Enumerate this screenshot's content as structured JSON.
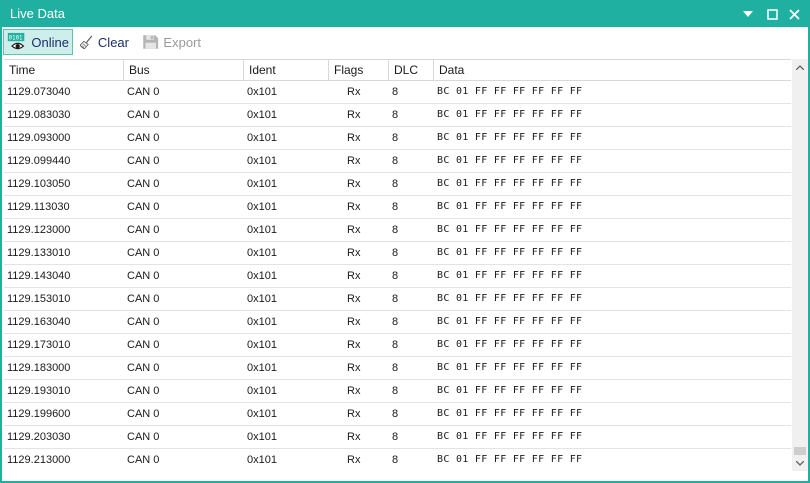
{
  "window": {
    "title": "Live Data"
  },
  "toolbar": {
    "online_label": "Online",
    "online_icon_text": "0101",
    "clear_label": "Clear",
    "export_label": "Export"
  },
  "columns": [
    "Time",
    "Bus",
    "Ident",
    "Flags",
    "DLC",
    "Data"
  ],
  "rows": [
    {
      "time": "1129.073040",
      "bus": "CAN 0",
      "ident": "0x101",
      "flags": "Rx",
      "dlc": "8",
      "data": "BC 01 FF FF FF FF FF FF"
    },
    {
      "time": "1129.083030",
      "bus": "CAN 0",
      "ident": "0x101",
      "flags": "Rx",
      "dlc": "8",
      "data": "BC 01 FF FF FF FF FF FF"
    },
    {
      "time": "1129.093000",
      "bus": "CAN 0",
      "ident": "0x101",
      "flags": "Rx",
      "dlc": "8",
      "data": "BC 01 FF FF FF FF FF FF"
    },
    {
      "time": "1129.099440",
      "bus": "CAN 0",
      "ident": "0x101",
      "flags": "Rx",
      "dlc": "8",
      "data": "BC 01 FF FF FF FF FF FF"
    },
    {
      "time": "1129.103050",
      "bus": "CAN 0",
      "ident": "0x101",
      "flags": "Rx",
      "dlc": "8",
      "data": "BC 01 FF FF FF FF FF FF"
    },
    {
      "time": "1129.113030",
      "bus": "CAN 0",
      "ident": "0x101",
      "flags": "Rx",
      "dlc": "8",
      "data": "BC 01 FF FF FF FF FF FF"
    },
    {
      "time": "1129.123000",
      "bus": "CAN 0",
      "ident": "0x101",
      "flags": "Rx",
      "dlc": "8",
      "data": "BC 01 FF FF FF FF FF FF"
    },
    {
      "time": "1129.133010",
      "bus": "CAN 0",
      "ident": "0x101",
      "flags": "Rx",
      "dlc": "8",
      "data": "BC 01 FF FF FF FF FF FF"
    },
    {
      "time": "1129.143040",
      "bus": "CAN 0",
      "ident": "0x101",
      "flags": "Rx",
      "dlc": "8",
      "data": "BC 01 FF FF FF FF FF FF"
    },
    {
      "time": "1129.153010",
      "bus": "CAN 0",
      "ident": "0x101",
      "flags": "Rx",
      "dlc": "8",
      "data": "BC 01 FF FF FF FF FF FF"
    },
    {
      "time": "1129.163040",
      "bus": "CAN 0",
      "ident": "0x101",
      "flags": "Rx",
      "dlc": "8",
      "data": "BC 01 FF FF FF FF FF FF"
    },
    {
      "time": "1129.173010",
      "bus": "CAN 0",
      "ident": "0x101",
      "flags": "Rx",
      "dlc": "8",
      "data": "BC 01 FF FF FF FF FF FF"
    },
    {
      "time": "1129.183000",
      "bus": "CAN 0",
      "ident": "0x101",
      "flags": "Rx",
      "dlc": "8",
      "data": "BC 01 FF FF FF FF FF FF"
    },
    {
      "time": "1129.193010",
      "bus": "CAN 0",
      "ident": "0x101",
      "flags": "Rx",
      "dlc": "8",
      "data": "BC 01 FF FF FF FF FF FF"
    },
    {
      "time": "1129.199600",
      "bus": "CAN 0",
      "ident": "0x101",
      "flags": "Rx",
      "dlc": "8",
      "data": "BC 01 FF FF FF FF FF FF"
    },
    {
      "time": "1129.203030",
      "bus": "CAN 0",
      "ident": "0x101",
      "flags": "Rx",
      "dlc": "8",
      "data": "BC 01 FF FF FF FF FF FF"
    },
    {
      "time": "1129.213000",
      "bus": "CAN 0",
      "ident": "0x101",
      "flags": "Rx",
      "dlc": "8",
      "data": "BC 01 FF FF FF FF FF FF"
    }
  ],
  "colors": {
    "accent": "#1fb0a2",
    "online_bg": "#cdeeea",
    "toolbar_text": "#1f2d6b",
    "disabled": "#9a9a9a"
  },
  "icons": {
    "online": "eye-icon",
    "clear": "broom-icon",
    "export": "floppy-disk-icon",
    "menu": "chevron-down-icon",
    "maximize": "maximize-icon",
    "close": "close-icon"
  }
}
